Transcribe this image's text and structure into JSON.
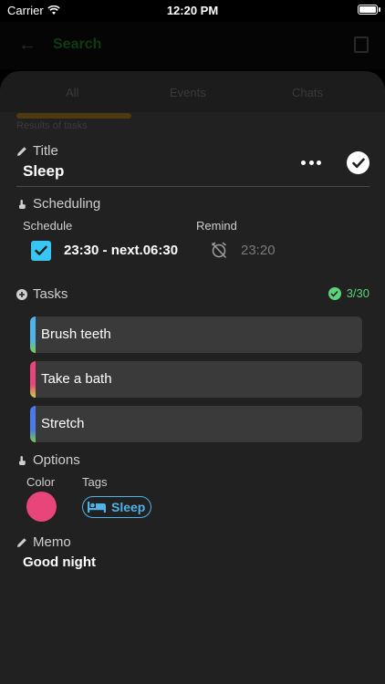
{
  "status_bar": {
    "carrier": "Carrier",
    "time": "12:20 PM"
  },
  "background_nav": {
    "title": "Search"
  },
  "background_tabs": [
    "All",
    "Events",
    "Chats"
  ],
  "background_results": "Results of tasks",
  "title_section": {
    "label": "Title",
    "value": "Sleep"
  },
  "scheduling": {
    "label": "Scheduling",
    "schedule_label": "Schedule",
    "schedule_value": "23:30 - next.06:30",
    "schedule_checked": true,
    "remind_label": "Remind",
    "remind_value": "23:20"
  },
  "tasks": {
    "label": "Tasks",
    "count": "3/30",
    "items": [
      {
        "label": "Brush teeth",
        "stripe_color": "#4fb3e8",
        "stripe_color_end": "#7ccb4a"
      },
      {
        "label": "Take a bath",
        "stripe_color": "#e8467a",
        "stripe_color_end": "#c7d64a"
      },
      {
        "label": "Stretch",
        "stripe_color": "#4a7ae8",
        "stripe_color_end": "#7ccb4a"
      }
    ]
  },
  "options": {
    "label": "Options",
    "color_label": "Color",
    "color_value": "#e8467a",
    "tags_label": "Tags",
    "tag": "Sleep"
  },
  "memo": {
    "label": "Memo",
    "value": "Good night"
  },
  "colors": {
    "accent_blue": "#38c6f4",
    "success": "#5cd27a",
    "tag_blue": "#4fb3e8"
  }
}
